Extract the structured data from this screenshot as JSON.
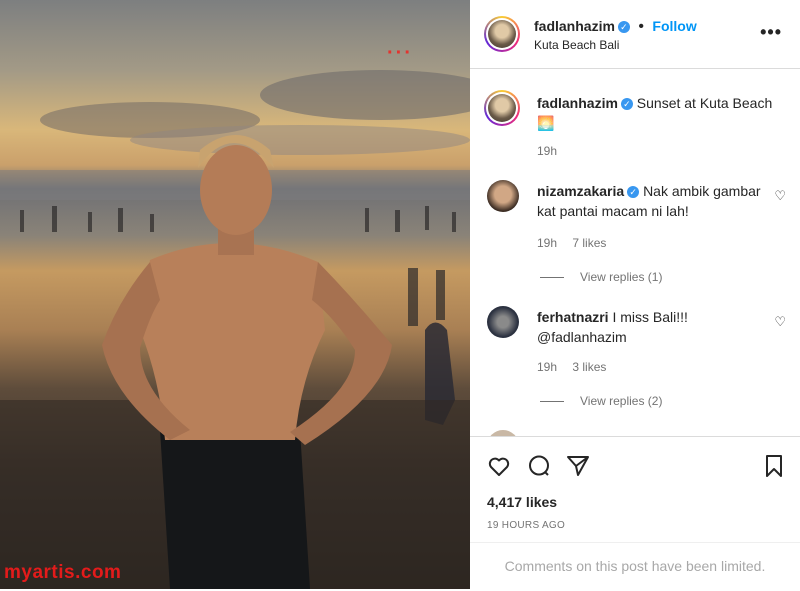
{
  "watermark": "myartis.com",
  "post": {
    "username": "fadlanhazim",
    "follow_label": "Follow",
    "location": "Kuta Beach Bali",
    "more_icon": "more-horizontal-icon"
  },
  "caption": {
    "username": "fadlanhazim",
    "text": "Sunset at Kuta Beach",
    "emoji": "🌅",
    "time": "19h"
  },
  "comments": [
    {
      "username": "nizamzakaria",
      "text": "Nak ambik gambar kat pantai macam ni lah!",
      "time": "19h",
      "likes": "7 likes",
      "replies": "View replies (1)"
    },
    {
      "username": "ferhatnazri",
      "text": "I miss Bali!!!",
      "mention": "@fadlanhazim",
      "time": "19h",
      "likes": "3 likes",
      "replies": "View replies (2)"
    }
  ],
  "engagement": {
    "likes": "4,417 likes",
    "timestamp": "19 HOURS AGO",
    "limited_notice": "Comments on this post have been limited."
  },
  "colors": {
    "link_blue": "#0095f6",
    "verified_blue": "#3897f0",
    "watermark_red": "#e31b1b"
  }
}
